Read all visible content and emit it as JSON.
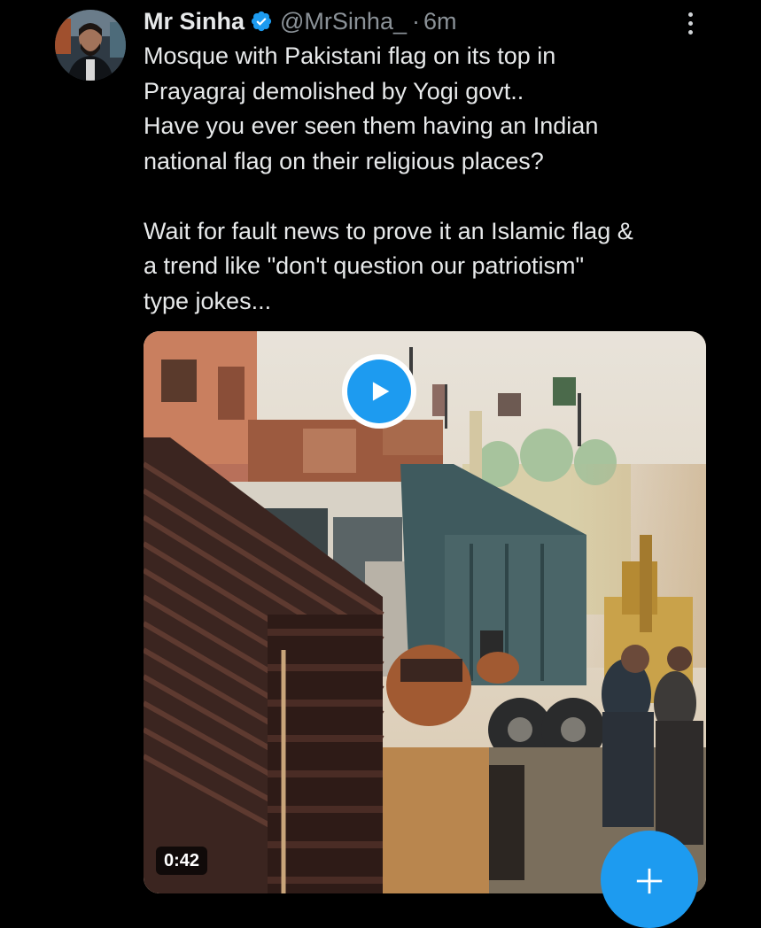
{
  "tweet": {
    "author": {
      "display_name": "Mr Sinha",
      "handle": "@MrSinha_",
      "verified": true,
      "avatar_icon": "profile-photo"
    },
    "separator": "·",
    "time": "6m",
    "more_icon": "vertical-ellipsis-icon",
    "text_lines": [
      "Mosque with Pakistani flag on its top in",
      "Prayagraj demolished by Yogi govt..",
      "Have you ever seen them having an Indian",
      "national flag on their religious places?",
      "",
      "Wait for fault news to prove it an Islamic flag &",
      "a trend like \"don't question our patriotism\"",
      "type jokes..."
    ],
    "media": {
      "type": "video",
      "duration": "0:42",
      "play_icon": "play-icon"
    }
  },
  "compose_button": {
    "icon": "plus-icon"
  },
  "colors": {
    "background": "#000000",
    "text_primary": "#e7e9ea",
    "text_secondary": "#8b9298",
    "accent": "#1d9bf0"
  }
}
